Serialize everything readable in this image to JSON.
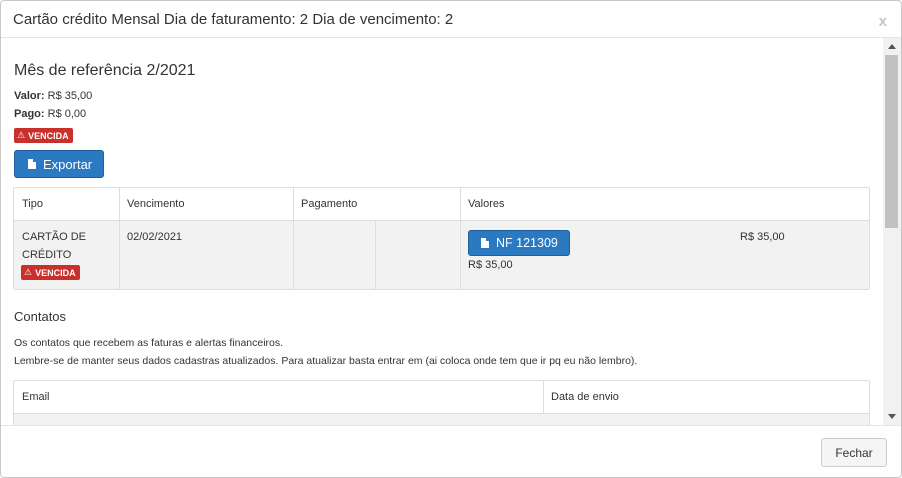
{
  "modal": {
    "title": "Cartão crédito Mensal Dia de faturamento: 2 Dia de vencimento: 2",
    "close": "x"
  },
  "reference": {
    "title": "Mês de referência 2/2021",
    "valor_label": "Valor:",
    "valor": "R$ 35,00",
    "pago_label": "Pago:",
    "pago": "R$ 0,00",
    "status_badge": "VENCIDA",
    "export_button": "Exportar"
  },
  "bill_table": {
    "columns": [
      "Tipo",
      "Vencimento",
      "Pagamento",
      "Valores"
    ],
    "row": {
      "tipo_line1": "CARTÃO DE",
      "tipo_line2": "CRÉDITO",
      "status_badge": "VENCIDA",
      "vencimento": "02/02/2021",
      "pagamento": "",
      "invoice_button": "NF 121309",
      "invoice_value": "R$ 35,00",
      "total": "R$ 35,00"
    }
  },
  "contacts": {
    "title": "Contatos",
    "line1": "Os contatos que recebem as faturas e alertas financeiros.",
    "line2": "Lembre-se de manter seus dados cadastras atualizados. Para atualizar basta entrar em (ai coloca onde tem que ir pq eu não lembro).",
    "columns": [
      "Email",
      "Data de envio"
    ]
  },
  "footer": {
    "close_button": "Fechar"
  },
  "colors": {
    "primary": "#2a79c1",
    "danger": "#c9302c"
  },
  "icons": {
    "warning": "⚠",
    "document": "document-icon"
  }
}
